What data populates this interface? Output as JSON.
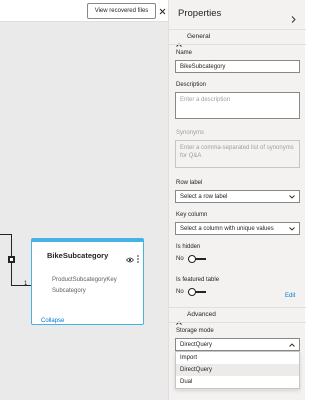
{
  "canvas": {
    "toolbar": {
      "recover_label": "View recovered files"
    },
    "relationship": {
      "cardinality_label": "1"
    },
    "table_card": {
      "title": "BikeSubcategory",
      "fields": [
        "ProductSubcategoryKey",
        "Subcategory"
      ],
      "collapse_label": "Collapse"
    }
  },
  "properties": {
    "title": "Properties",
    "general": {
      "header": "General",
      "name": {
        "label": "Name",
        "value": "BikeSubcategory"
      },
      "description": {
        "label": "Description",
        "placeholder": "Enter a description"
      },
      "synonyms": {
        "label": "Synonyms",
        "placeholder": "Enter a comma-separated list of synonyms for Q&A"
      },
      "row_label": {
        "label": "Row label",
        "value": "Select a row label"
      },
      "key_column": {
        "label": "Key column",
        "value": "Select a column with unique values"
      },
      "is_hidden": {
        "label": "Is hidden",
        "state": "No"
      },
      "is_featured": {
        "label": "Is featured table",
        "state": "No"
      },
      "edit_label": "Edit"
    },
    "advanced": {
      "header": "Advanced",
      "storage_mode": {
        "label": "Storage mode",
        "value": "DirectQuery",
        "options": [
          "Import",
          "DirectQuery",
          "Dual"
        ]
      }
    }
  },
  "colors": {
    "accent": "#0078d4",
    "table_border": "#46b3e6",
    "pane_bg": "#f3f2f1",
    "canvas_bg": "#eaeaea"
  }
}
